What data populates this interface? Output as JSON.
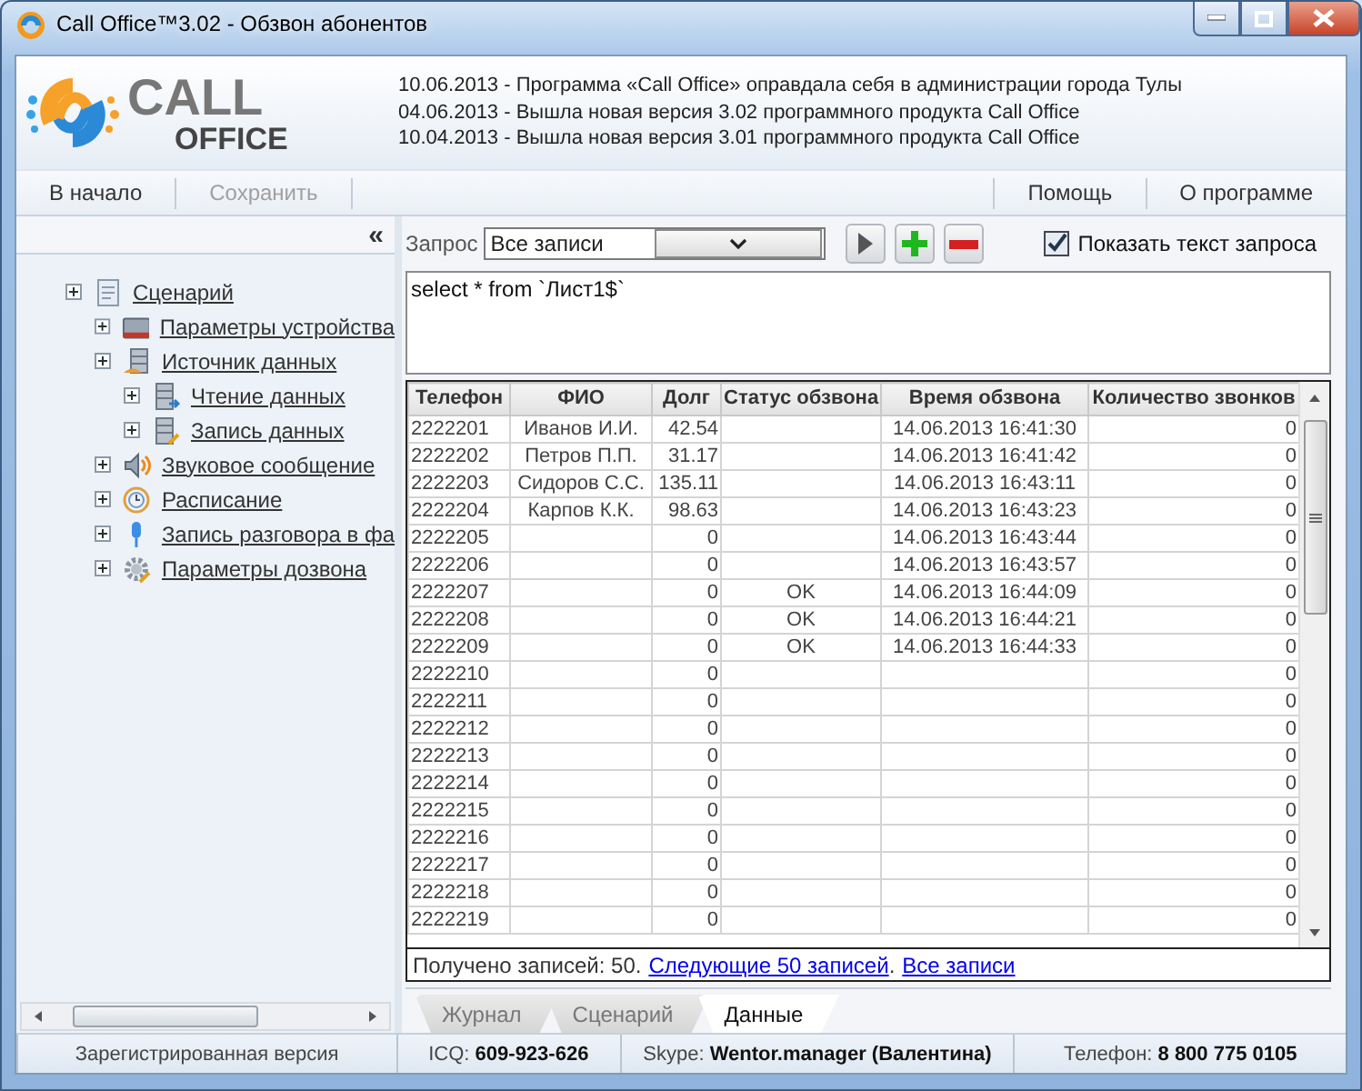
{
  "window": {
    "title": "Call Office™3.02 - Обзвон абонентов"
  },
  "header": {
    "logo_top": "CALL",
    "logo_bottom": "OFFICE",
    "news": [
      "10.06.2013 - Программа «Call Office» оправдала себя в администрации города Тулы",
      "04.06.2013 - Вышла новая версия 3.02 программного продукта Call Office",
      "10.04.2013 - Вышла новая версия 3.01 программного продукта Call Office"
    ]
  },
  "toolbar": {
    "left": [
      {
        "label": "В начало",
        "disabled": false
      },
      {
        "label": "Сохранить",
        "disabled": true
      }
    ],
    "right": [
      {
        "label": "Помощь",
        "disabled": false
      },
      {
        "label": "О программе",
        "disabled": false
      }
    ]
  },
  "sidebar": {
    "collapse": "«",
    "tree": [
      {
        "label": "Сценарий",
        "children": [
          {
            "label": "Параметры устройства"
          },
          {
            "label": "Источник данных",
            "children": [
              {
                "label": "Чтение данных"
              },
              {
                "label": "Запись данных"
              }
            ]
          },
          {
            "label": "Звуковое сообщение"
          },
          {
            "label": "Расписание"
          },
          {
            "label": "Запись разговора в фа"
          },
          {
            "label": "Параметры дозвона"
          }
        ]
      }
    ]
  },
  "query": {
    "label": "Запрос",
    "value": "Все записи",
    "show_text": {
      "label": "Показать текст запроса",
      "checked": true
    },
    "text": "select * from `Лист1$`"
  },
  "table": {
    "columns": [
      {
        "label": "Телефон"
      },
      {
        "label": "ФИО"
      },
      {
        "label": "Долг"
      },
      {
        "label": "Статус обзвона"
      },
      {
        "label": "Время обзвона"
      },
      {
        "label": "Количество звонков"
      }
    ],
    "rows": [
      {
        "phone": "2222201",
        "name": "Иванов И.И.",
        "debt": "42.54",
        "time": "14.06.2013 16:41:30",
        "calls": "0"
      },
      {
        "phone": "2222202",
        "name": "Петров П.П.",
        "debt": "31.17",
        "time": "14.06.2013 16:41:42",
        "calls": "0"
      },
      {
        "phone": "2222203",
        "name": "Сидоров С.С.",
        "debt": "135.11",
        "time": "14.06.2013 16:43:11",
        "calls": "0"
      },
      {
        "phone": "2222204",
        "name": "Карпов К.К.",
        "debt": "98.63",
        "time": "14.06.2013 16:43:23",
        "calls": "0"
      },
      {
        "phone": "2222205",
        "debt": "0",
        "time": "14.06.2013 16:43:44",
        "calls": "0"
      },
      {
        "phone": "2222206",
        "debt": "0",
        "time": "14.06.2013 16:43:57",
        "calls": "0"
      },
      {
        "phone": "2222207",
        "debt": "0",
        "status": "OK",
        "time": "14.06.2013 16:44:09",
        "calls": "0"
      },
      {
        "phone": "2222208",
        "debt": "0",
        "status": "OK",
        "time": "14.06.2013 16:44:21",
        "calls": "0"
      },
      {
        "phone": "2222209",
        "debt": "0",
        "status": "OK",
        "time": "14.06.2013 16:44:33",
        "calls": "0"
      },
      {
        "phone": "2222210",
        "debt": "0",
        "calls": "0"
      },
      {
        "phone": "2222211",
        "debt": "0",
        "calls": "0"
      },
      {
        "phone": "2222212",
        "debt": "0",
        "calls": "0"
      },
      {
        "phone": "2222213",
        "debt": "0",
        "calls": "0"
      },
      {
        "phone": "2222214",
        "debt": "0",
        "calls": "0"
      },
      {
        "phone": "2222215",
        "debt": "0",
        "calls": "0"
      },
      {
        "phone": "2222216",
        "debt": "0",
        "calls": "0"
      },
      {
        "phone": "2222217",
        "debt": "0",
        "calls": "0"
      },
      {
        "phone": "2222218",
        "debt": "0",
        "calls": "0"
      },
      {
        "phone": "2222219",
        "debt": "0",
        "calls": "0"
      }
    ]
  },
  "footer": [
    {
      "kind": "text",
      "text": "Получено записей: 50."
    },
    {
      "kind": "link",
      "text": "Следующие 50 записей"
    },
    {
      "kind": "text",
      "text": "."
    },
    {
      "kind": "link",
      "text": "Все записи"
    }
  ],
  "tabs": [
    {
      "label": "Журнал",
      "selected": false
    },
    {
      "label": "Сценарий",
      "selected": false
    },
    {
      "label": "Данные",
      "selected": true
    }
  ],
  "status_bar": [
    {
      "text": "Зарегистрированная версия"
    },
    {
      "text": "ICQ: **609-923-626**"
    },
    {
      "text": "Skype: **Wentor.manager (Валентина)**"
    },
    {
      "text": "Телефон: **8 800 775 0105**"
    }
  ]
}
